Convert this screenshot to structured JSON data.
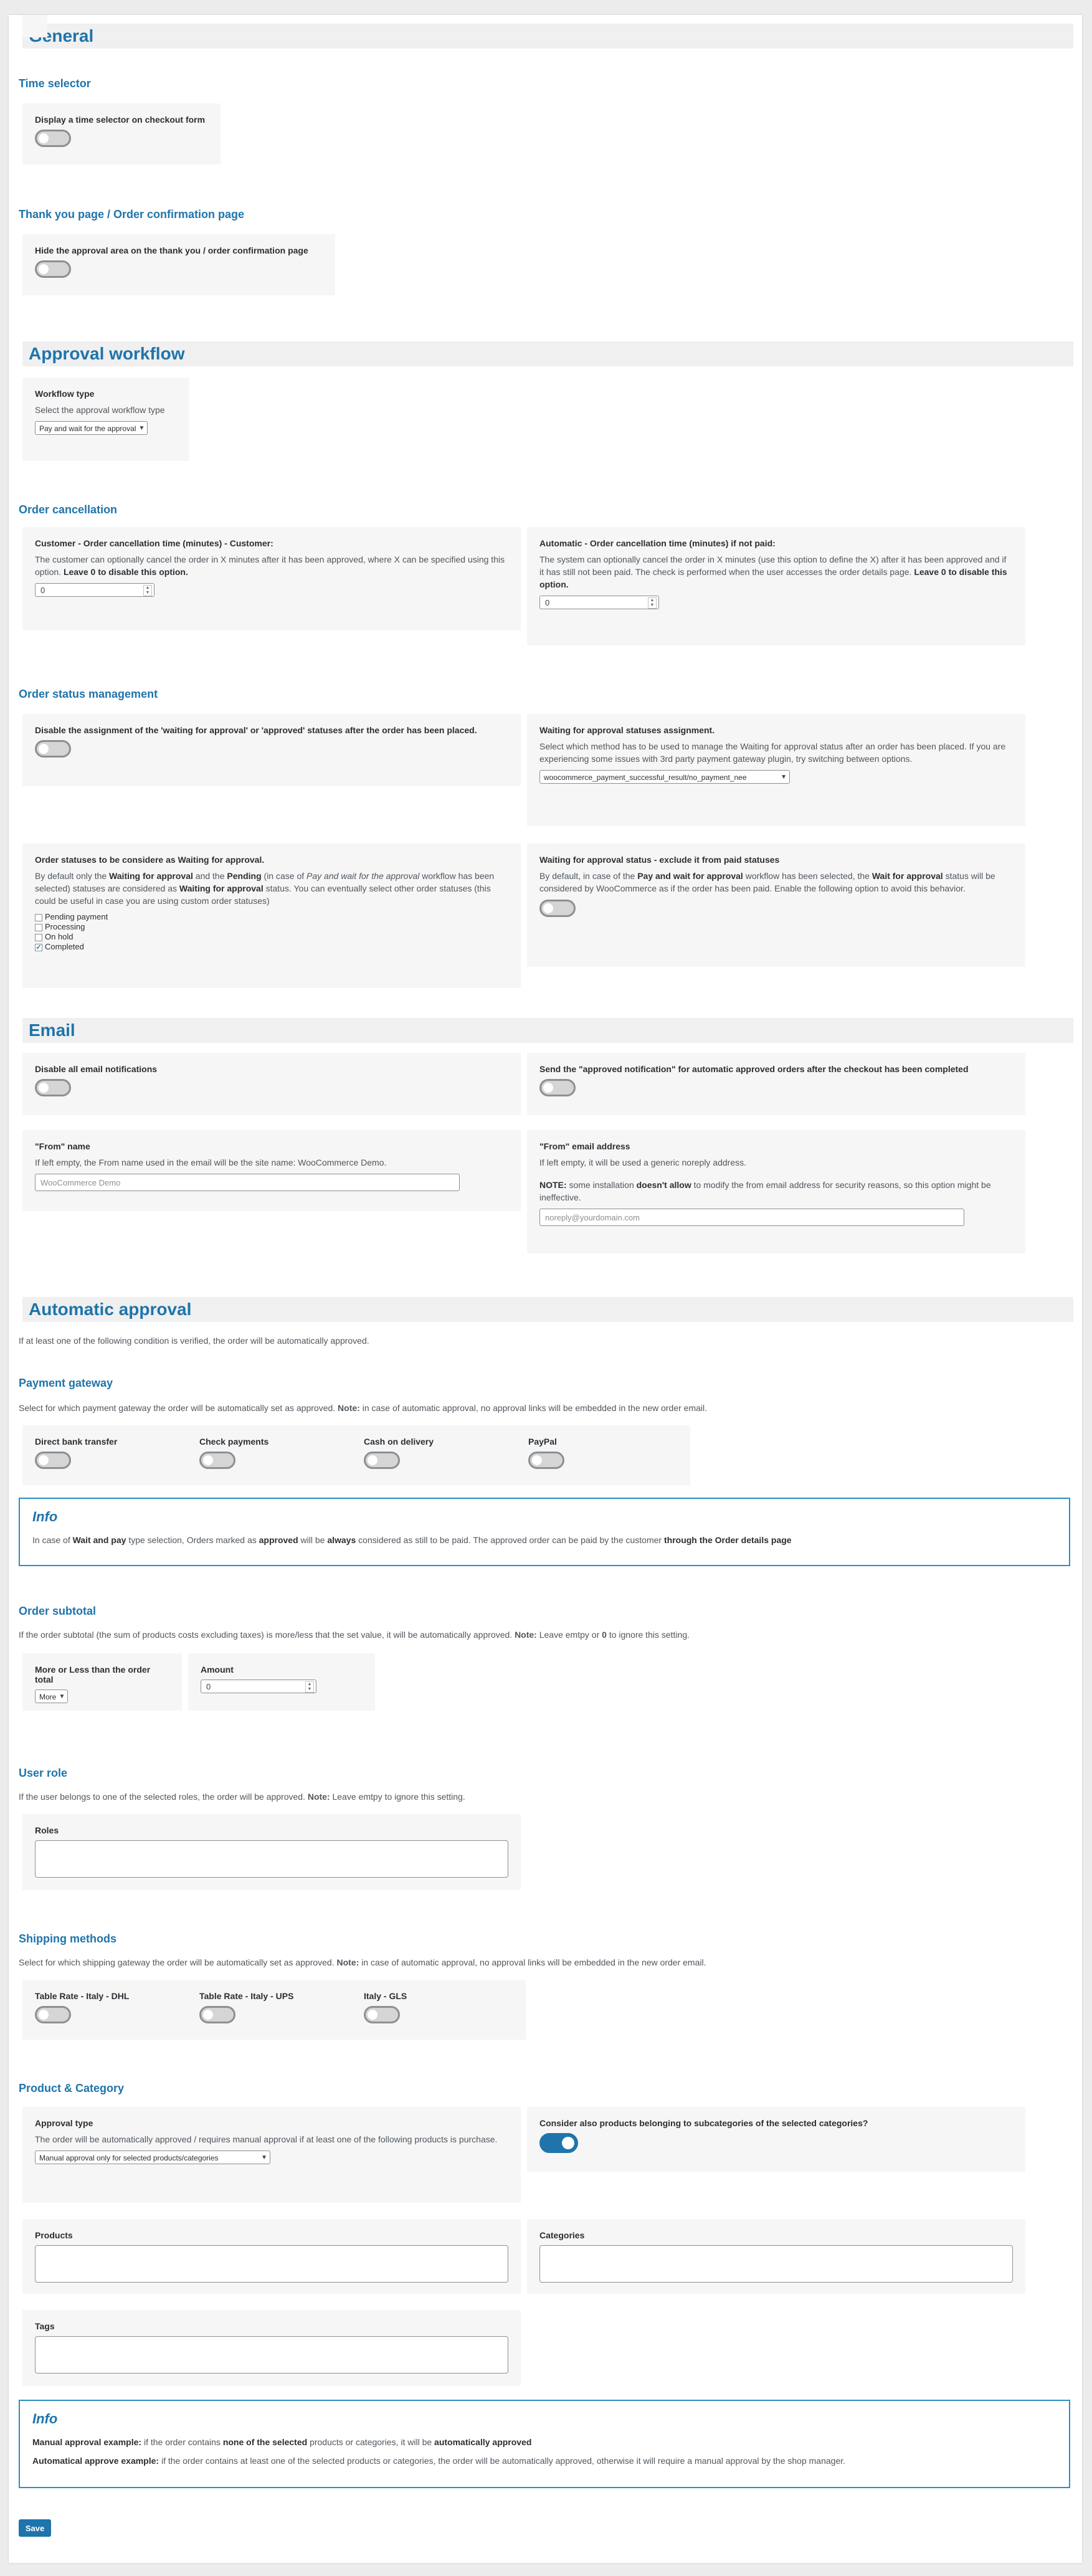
{
  "general": {
    "title": "General",
    "time_selector_title": "Time selector",
    "time_selector_label": "Display a time selector on checkout form",
    "thankyou_title": "Thank you page / Order confirmation page",
    "thankyou_label": "Hide the approval area on the thank you / order confirmation page"
  },
  "approval_workflow": {
    "title": "Approval workflow",
    "workflow_type_label": "Workflow type",
    "workflow_type_desc": "Select the approval workflow type",
    "workflow_type_value": "Pay and wait for the approval",
    "order_cancellation_title": "Order cancellation",
    "customer_cancel_label": "Customer - Order cancellation time (minutes) - Customer:",
    "customer_cancel_desc": "The customer can optionally cancel the order in X minutes after it has been approved, where X can be specified using this option.",
    "customer_cancel_desc_bold": "Leave 0 to disable this option.",
    "customer_cancel_value": "0",
    "auto_cancel_label": "Automatic - Order cancellation time (minutes) if not paid:",
    "auto_cancel_desc": "The system can optionally cancel the order in X minutes (use this option to define the X) after it has been approved and if it has still not been paid. The check is performed when the user accesses the order details page.",
    "auto_cancel_desc_bold": "Leave 0 to disable this option.",
    "auto_cancel_value": "0",
    "status_mgmt_title": "Order status management",
    "disable_assign_label": "Disable the assignment of the 'waiting for approval' or 'approved' statuses after the order has been placed.",
    "waiting_assign_label": "Waiting for approval statuses assignment.",
    "waiting_assign_desc": "Select which method has to be used to manage the Waiting for approval status after an order has been placed. If you are experiencing some issues with 3rd party payment gateway plugin, try switching between options.",
    "waiting_assign_value": "woocommerce_payment_successful_result/no_payment_nee",
    "statuses_label": "Order statuses to be considere as Waiting for approval.",
    "statuses_desc_1": "By default only the",
    "statuses_desc_b1": "Waiting for approval",
    "statuses_desc_2": "and the",
    "statuses_desc_b2": "Pending",
    "statuses_desc_3": "(in case of",
    "statuses_desc_i1": "Pay and wait for the approval",
    "statuses_desc_4": "workflow has been selected) statuses are considered as",
    "statuses_desc_b3": "Waiting for approval",
    "statuses_desc_5": "status. You can eventually select other order statuses (this could be useful in case you are using custom order statuses)",
    "statuses_options": [
      "Pending payment",
      "Processing",
      "On hold",
      "Completed"
    ],
    "statuses_checked_mark": "✓",
    "exclude_paid_label": "Waiting for approval status - exclude it from paid statuses",
    "exclude_paid_desc_1": "By default, in case of the",
    "exclude_paid_desc_b1": "Pay and wait for approval",
    "exclude_paid_desc_2": "workflow has been selected, the",
    "exclude_paid_desc_b2": "Wait for approval",
    "exclude_paid_desc_3": "status will be considered by WooCommerce as if the order has been paid. Enable the following option to avoid this behavior."
  },
  "email": {
    "title": "Email",
    "disable_all_label": "Disable all email notifications",
    "send_approved_label": "Send the \"approved notification\" for automatic approved orders after the checkout has been completed",
    "from_name_label": "\"From\" name",
    "from_name_desc": "If left empty, the From name used in the email will be the site name: WooCommerce Demo.",
    "from_name_placeholder": "WooCommerce Demo",
    "from_email_label": "\"From\" email address",
    "from_email_desc": "If left empty, it will be used a generic noreply address.",
    "from_email_note_b1": "NOTE:",
    "from_email_note_1": "some installation",
    "from_email_note_b2": "doesn't allow",
    "from_email_note_2": "to modify the from email address for security reasons, so this option might be ineffective.",
    "from_email_placeholder": "noreply@yourdomain.com"
  },
  "automatic_approval": {
    "title": "Automatic approval",
    "intro": "If at least one of the following condition is verified, the order will be automatically approved.",
    "payment_gateway_title": "Payment gateway",
    "payment_gateway_desc_1": "Select for which payment gateway the order will be automatically set as approved.",
    "payment_gateway_desc_b": "Note:",
    "payment_gateway_desc_2": "in case of automatic approval, no approval links will be embedded in the new order email.",
    "gateways": [
      "Direct bank transfer",
      "Check payments",
      "Cash on delivery",
      "PayPal"
    ],
    "info1_title": "Info",
    "info1_text_1": "In case of",
    "info1_text_b1": "Wait and pay",
    "info1_text_2": "type selection, Orders marked as",
    "info1_text_b2": "approved",
    "info1_text_3": "will be",
    "info1_text_b3": "always",
    "info1_text_4": "considered as still to be paid. The approved order can be paid by the customer",
    "info1_text_b4": "through the Order details page",
    "subtotal_title": "Order subtotal",
    "subtotal_desc_1": "If the order subtotal (the sum of products costs excluding taxes) is more/less that the set value, it will be automatically approved.",
    "subtotal_desc_b": "Note:",
    "subtotal_desc_2": "Leave emtpy or",
    "subtotal_desc_b2": "0",
    "subtotal_desc_3": "to ignore this setting.",
    "more_less_label": "More or Less than the order total",
    "more_less_value": "More",
    "amount_label": "Amount",
    "amount_value": "0",
    "user_role_title": "User role",
    "user_role_desc_1": "If the user belongs to one of the selected roles, the order will be approved.",
    "user_role_desc_b": "Note:",
    "user_role_desc_2": "Leave emtpy to ignore this setting.",
    "roles_label": "Roles",
    "shipping_title": "Shipping methods",
    "shipping_desc_1": "Select for which shipping gateway the order will be automatically set as approved.",
    "shipping_desc_b": "Note:",
    "shipping_desc_2": "in case of automatic approval, no approval links will be embedded in the new order email.",
    "shipping_methods": [
      "Table Rate - Italy - DHL",
      "Table Rate - Italy - UPS",
      "Italy - GLS"
    ],
    "product_category_title": "Product & Category",
    "approval_type_label": "Approval type",
    "approval_type_desc": "The order will be automatically approved / requires manual approval if at least one of the following products is purchase.",
    "approval_type_value": "Manual approval only for selected products/categories",
    "subcategories_label": "Consider also products belonging to subcategories of the selected categories?",
    "products_label": "Products",
    "categories_label": "Categories",
    "tags_label": "Tags",
    "info2_title": "Info",
    "info2_line1_b1": "Manual approval example:",
    "info2_line1_1": "if the order contains",
    "info2_line1_b2": "none of the selected",
    "info2_line1_2": "products or categories, it will be",
    "info2_line1_b3": "automatically approved",
    "info2_line2_b1": "Automatical approve example:",
    "info2_line2_1": "if the order contains at least one of the selected products or categories, the order will be automatically approved, otherwise it will require a manual approval by the shop manager."
  },
  "save_label": "Save",
  "colors": {
    "accent": "#1f74ab",
    "card_bg": "#f6f6f6",
    "band_bg": "#f0f0f0"
  }
}
